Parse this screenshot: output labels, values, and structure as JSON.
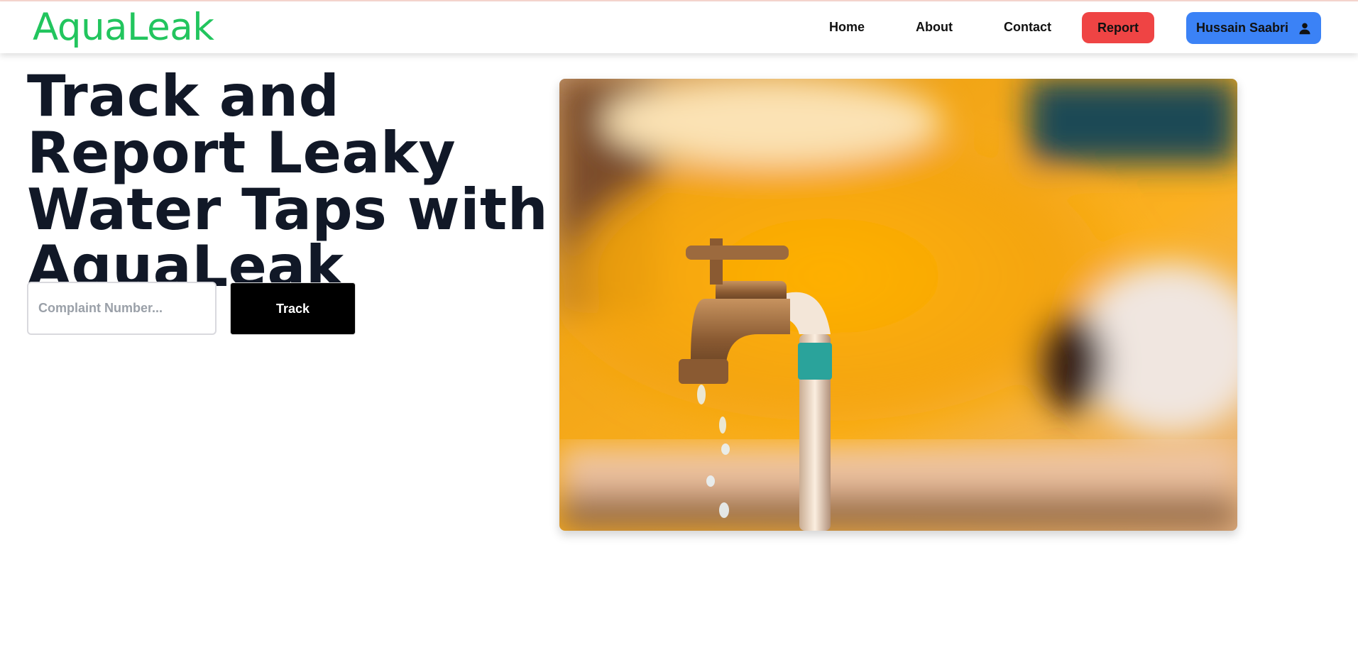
{
  "brand": {
    "name": "AquaLeak",
    "color": "#22c55e"
  },
  "nav": {
    "home": "Home",
    "about": "About",
    "contact": "Contact",
    "report": "Report",
    "user_name": "Hussain Saabri"
  },
  "hero": {
    "title": "Track and Report Leaky Water Taps with AquaLeak",
    "image_alt": "Leaking brass water tap with water droplets"
  },
  "tracker": {
    "placeholder": "Complaint Number...",
    "value": "",
    "button": "Track"
  },
  "icons": {
    "user": "user-icon"
  },
  "colors": {
    "report_button": "#ef4444",
    "user_button": "#3b82f6",
    "track_button": "#000000",
    "title_text": "#111827"
  }
}
